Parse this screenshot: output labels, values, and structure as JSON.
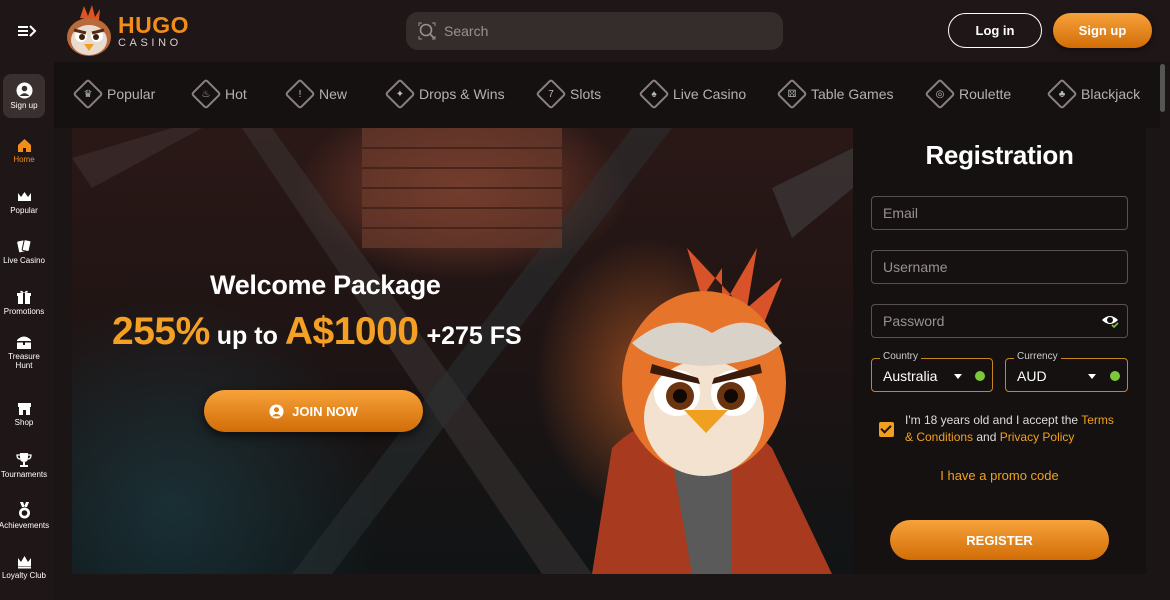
{
  "header": {
    "brand_main": "HUGO",
    "brand_sub": "CASINO",
    "search_placeholder": "Search",
    "login_label": "Log in",
    "signup_label": "Sign up"
  },
  "sidebar": {
    "signup_label": "Sign up",
    "items": [
      {
        "label": "Home",
        "icon": "home-icon",
        "active": true
      },
      {
        "label": "Popular",
        "icon": "crown-icon"
      },
      {
        "label": "Live Casino",
        "icon": "cards-icon"
      },
      {
        "label": "Promotions",
        "icon": "gift-icon"
      },
      {
        "label": "Treasure",
        "label2": "Hunt",
        "icon": "chest-icon"
      },
      {
        "label": "Shop",
        "icon": "shop-icon"
      },
      {
        "label": "Tournaments",
        "icon": "trophy-icon"
      },
      {
        "label": "Achievements",
        "icon": "medal-icon"
      },
      {
        "label": "Loyalty Club",
        "icon": "crown-icon"
      }
    ]
  },
  "categories": [
    {
      "label": "Popular",
      "icon": "crown-icon"
    },
    {
      "label": "Hot",
      "icon": "flame-icon"
    },
    {
      "label": "New",
      "icon": "alert-icon"
    },
    {
      "label": "Drops & Wins",
      "icon": "drops-icon"
    },
    {
      "label": "Slots",
      "icon": "slot-icon"
    },
    {
      "label": "Live Casino",
      "icon": "cards-icon"
    },
    {
      "label": "Table Games",
      "icon": "dice-icon"
    },
    {
      "label": "Roulette",
      "icon": "roulette-icon"
    },
    {
      "label": "Blackjack",
      "icon": "blackjack-icon"
    }
  ],
  "banner": {
    "title": "Welcome Package",
    "percent": "255%",
    "up_to": "up to",
    "amount": "A$1000",
    "free_spins": "+275 FS",
    "cta": "JOIN NOW"
  },
  "registration": {
    "title": "Registration",
    "email_placeholder": "Email",
    "username_placeholder": "Username",
    "password_placeholder": "Password",
    "country_label": "Country",
    "country_value": "Australia",
    "currency_label": "Currency",
    "currency_value": "AUD",
    "terms_prefix": "I'm 18 years old and I accept the ",
    "terms_link": "Terms & Conditions",
    "terms_and": " and ",
    "privacy_link": "Privacy Policy",
    "promo_link": "I have a promo code",
    "register_label": "REGISTER"
  },
  "colors": {
    "accent": "#f28d1a",
    "background": "#1c1515",
    "valid_dot": "#7cc83a"
  }
}
